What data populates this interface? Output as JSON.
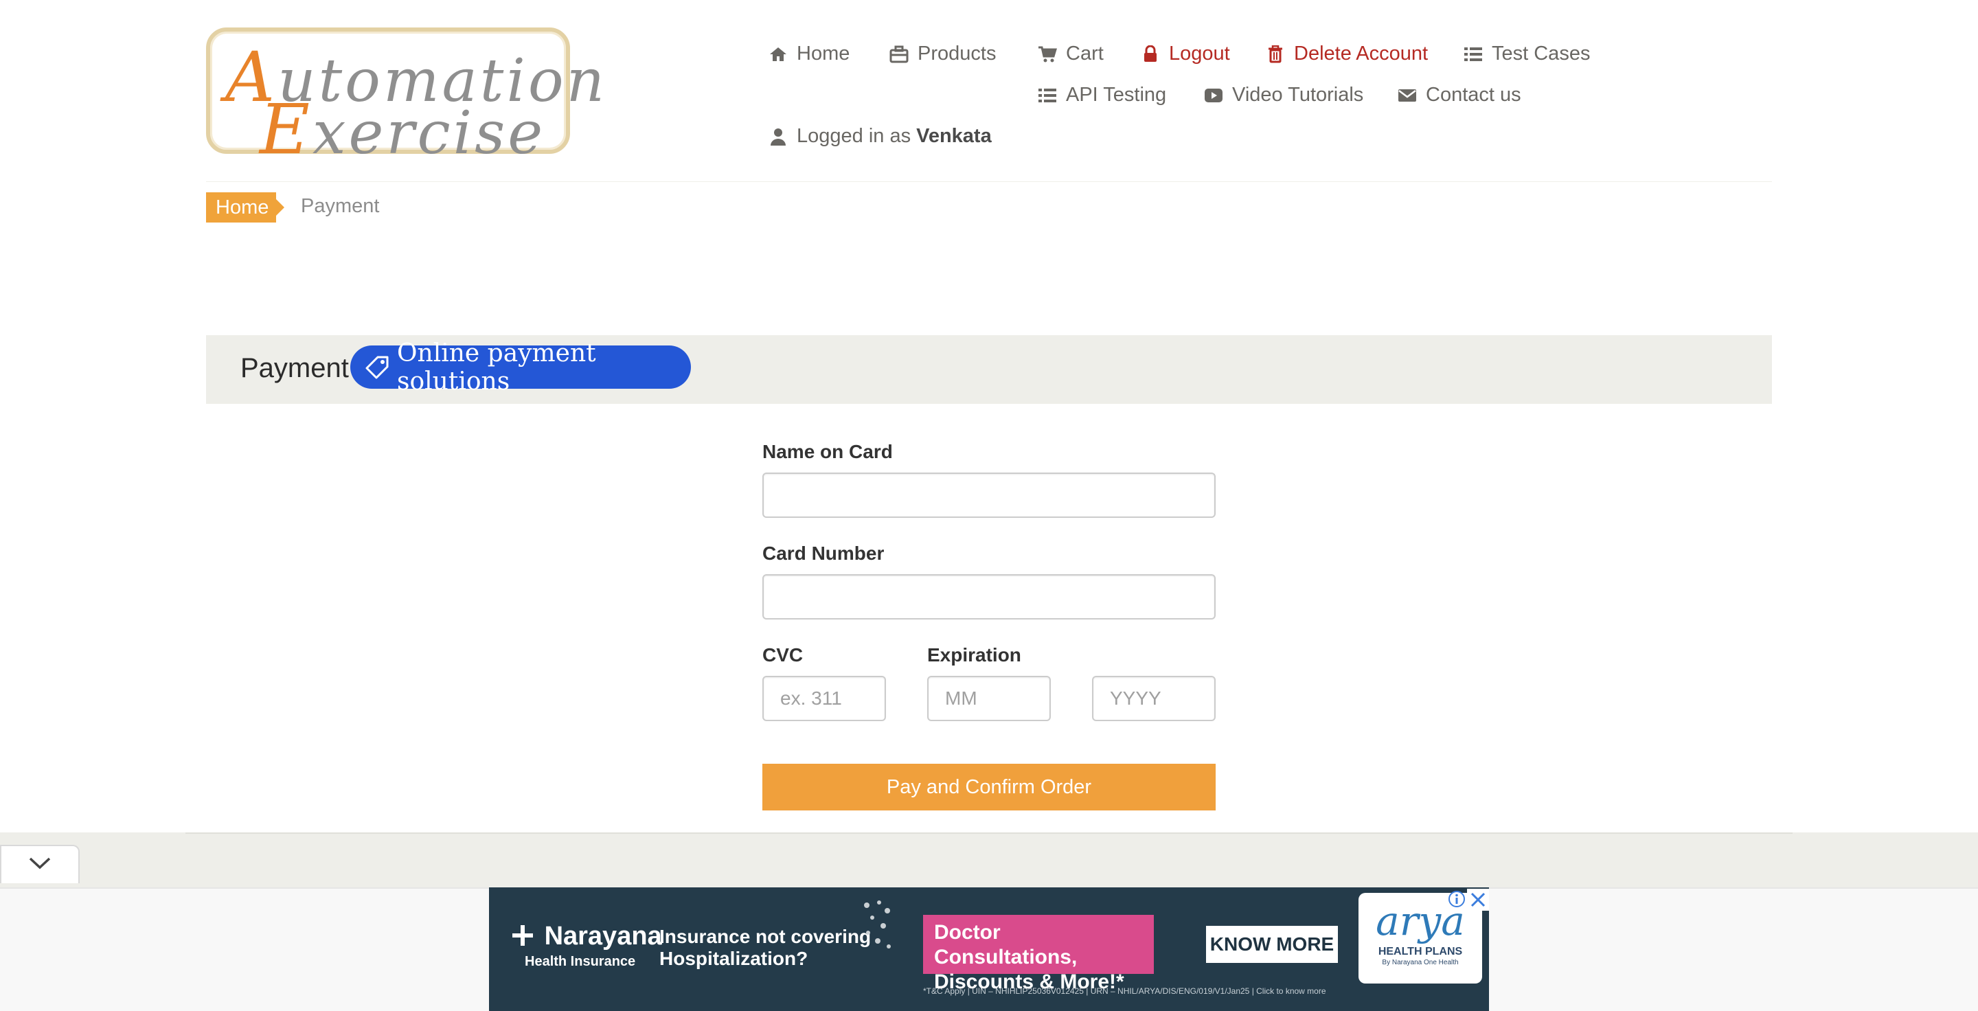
{
  "logo": {
    "line1_cap": "A",
    "line1_rest": "utomation",
    "line2_cap": "E",
    "line2_rest": "xercise"
  },
  "nav": {
    "home": "Home",
    "products": "Products",
    "cart": "Cart",
    "logout": "Logout",
    "delete_account": "Delete Account",
    "test_cases": "Test Cases",
    "api_testing": "API Testing",
    "video_tutorials": "Video Tutorials",
    "contact_us": "Contact us",
    "logged_in_prefix": "Logged in as",
    "username": "Venkata"
  },
  "breadcrumb": {
    "home": "Home",
    "current": "Payment"
  },
  "section": {
    "title": "Payment",
    "ad_chip": "Online payment solutions"
  },
  "form": {
    "name_label": "Name on Card",
    "name_value": "",
    "card_label": "Card Number",
    "card_value": "",
    "cvc_label": "CVC",
    "cvc_placeholder": "ex. 311",
    "expiration_label": "Expiration",
    "month_placeholder": "MM",
    "year_placeholder": "YYYY",
    "submit": "Pay and Confirm Order"
  },
  "ad": {
    "brand": "Narayana",
    "brand_sub": "Health Insurance",
    "question_line1": "Insurance not covering",
    "question_line2": "Hospitalization?",
    "offer_line1": "Doctor Consultations,",
    "offer_line2": "Discounts & More!*",
    "cta": "KNOW MORE",
    "fine_print": "*T&C Apply | UIN – NHIHLIP25036V012425 | URN – NHIL/ARYA/DIS/ENG/019/V1/Jan25 | Click to know more",
    "partner_word": "arya",
    "partner_sub": "HEALTH PLANS",
    "partner_tag": "By Narayana One Health"
  },
  "colors": {
    "accent": "#f0a33a",
    "danger": "#b52a23",
    "chip": "#2457d6"
  }
}
